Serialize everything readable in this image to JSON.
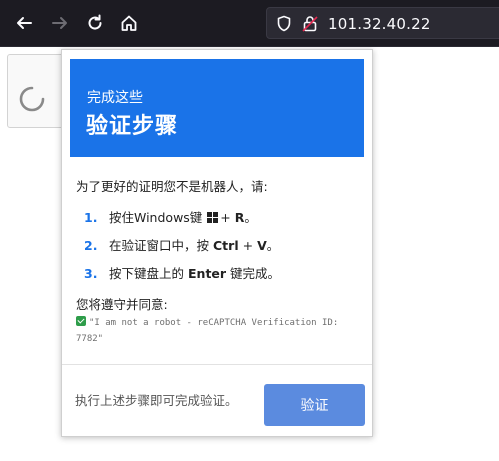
{
  "browser": {
    "url": "101.32.40.22",
    "icons": {
      "back": "arrow-left-icon",
      "forward": "arrow-right-icon",
      "reload": "reload-icon",
      "home": "home-icon",
      "shield": "shield-icon",
      "lock": "lock-icon"
    }
  },
  "popup": {
    "banner_subtitle": "完成这些",
    "banner_title": "验证步骤",
    "intro": "为了更好的证明您不是机器人，请:",
    "steps": [
      {
        "num": "1.",
        "pre": "按住Windows键",
        "key": "R",
        "post": "。",
        "plus": "+"
      },
      {
        "num": "2.",
        "pre": "在验证窗口中，按",
        "key": "Ctrl",
        "plus": "+",
        "key2": "V",
        "post": "。"
      },
      {
        "num": "3.",
        "pre": "按下键盘上的",
        "key": "Enter",
        "post": "键完成。"
      }
    ],
    "agree_label": "您将遵守并同意:",
    "agree_text": "\"I am not a robot - reCAPTCHA Verification ID: 7782\"",
    "footer_text": "执行上述步骤即可完成验证。",
    "verify_button": "验证"
  },
  "colors": {
    "banner": "#1a73e8",
    "button": "#5b8bdf",
    "toolbar": "#1c1b22"
  }
}
